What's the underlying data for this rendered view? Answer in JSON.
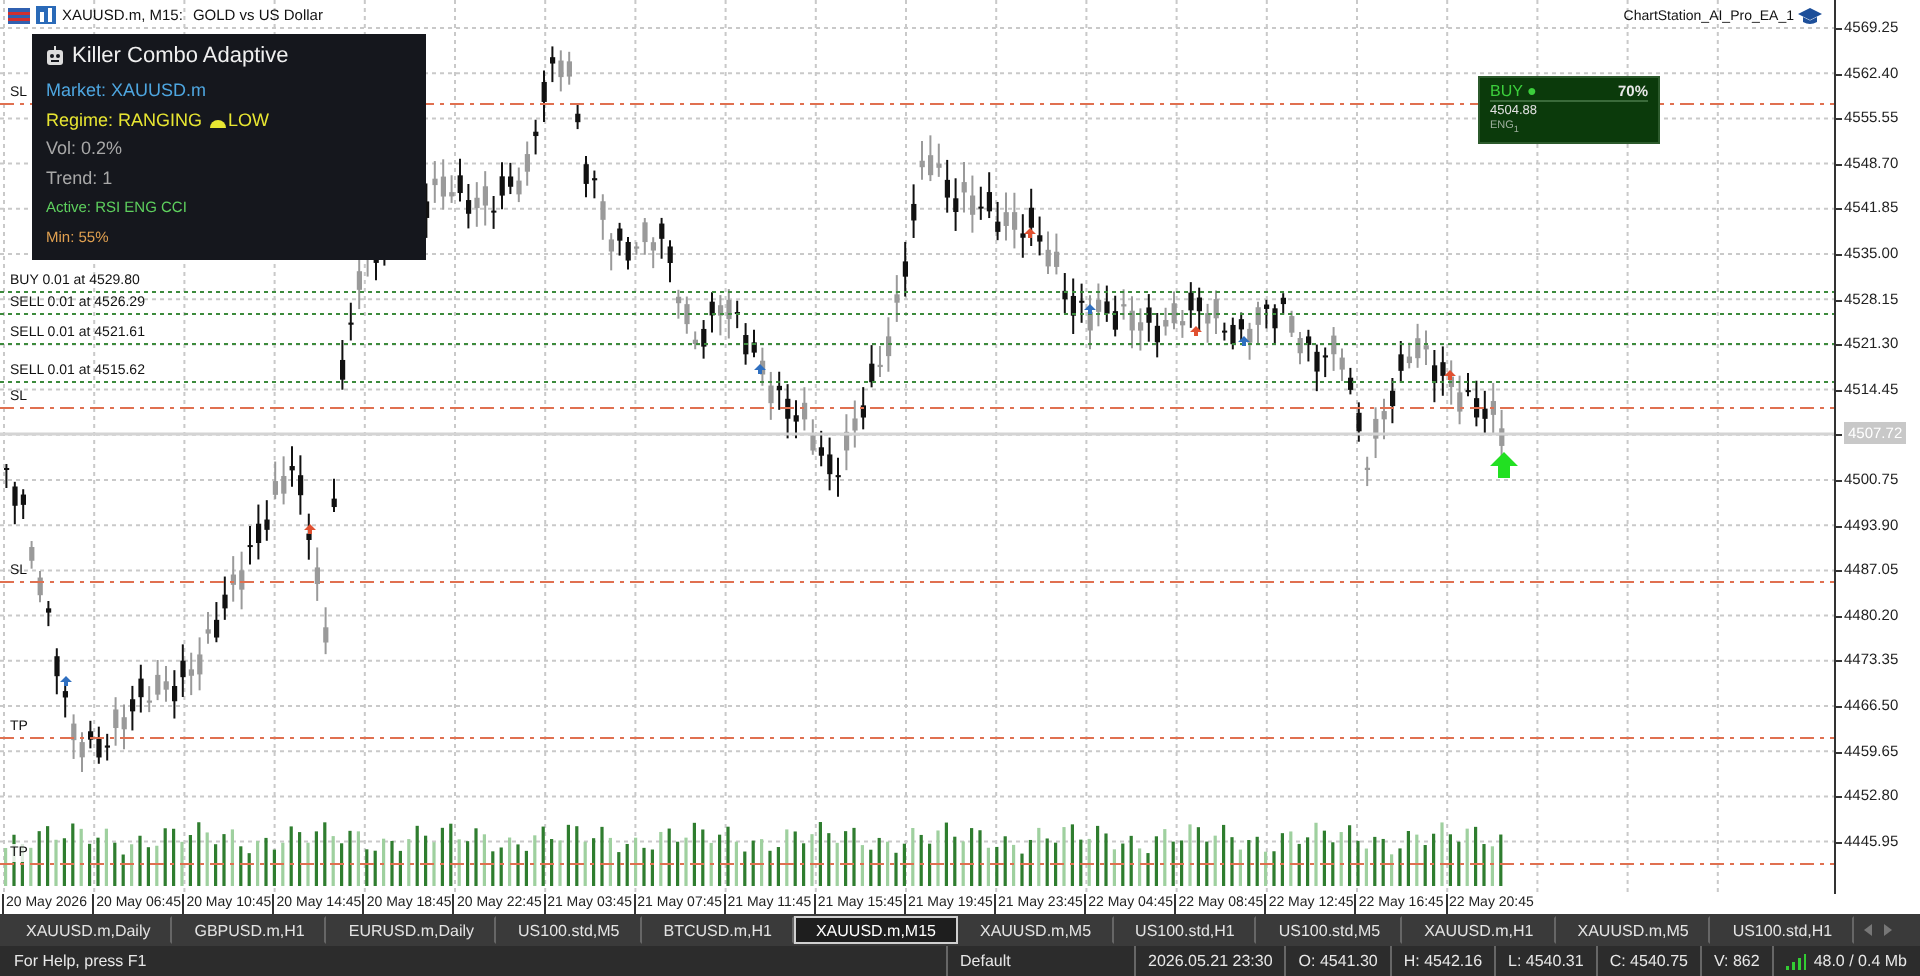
{
  "chart_header": {
    "symbol": "XAUUSD.m, M15:",
    "description": "GOLD vs US Dollar"
  },
  "info_panel": {
    "title": "Killer Combo Adaptive",
    "lines": [
      {
        "kind": "text",
        "text": "Market: XAUUSD.m",
        "color": "#4ea6e0"
      },
      {
        "kind": "regime",
        "text": "Regime: RANGING",
        "badge": "LOW",
        "color": "#e8e632"
      },
      {
        "kind": "text",
        "text": "Vol: 0.2%",
        "color": "#a8a8a8"
      },
      {
        "kind": "text",
        "text": "Trend: 1",
        "color": "#a8a8a8"
      },
      {
        "kind": "small",
        "text": "Active: RSI ENG CCI",
        "color": "#5ed05e"
      },
      {
        "kind": "small",
        "text": "Min: 55%",
        "color": "#e0a050"
      }
    ]
  },
  "expert": {
    "name": "ChartStation_AI_Pro_EA_1"
  },
  "signal": {
    "direction": "BUY ●",
    "confidence": "70%",
    "price": "4504.88",
    "tag": "ENG$_{1}$"
  },
  "levels": [
    {
      "kind": "stop",
      "label": "SL"
    },
    {
      "kind": "order",
      "label": "BUY 0.01 at 4529.80"
    },
    {
      "kind": "order",
      "label": "SELL 0.01 at 4526.29"
    },
    {
      "kind": "order",
      "label": "SELL 0.01 at 4521.61"
    },
    {
      "kind": "order",
      "label": "SELL 0.01 at 4515.62"
    },
    {
      "kind": "stop",
      "label": "SL"
    },
    {
      "kind": "stop",
      "label": "SL"
    },
    {
      "kind": "stop",
      "label": "TP"
    },
    {
      "kind": "stop",
      "label": "TP"
    }
  ],
  "price_axis": {
    "ticks": [
      "4569.25",
      "4562.40",
      "4555.55",
      "4548.70",
      "4541.85",
      "4535.00",
      "4528.15",
      "4521.30",
      "4514.45",
      "4500.75",
      "4493.90",
      "4487.05",
      "4480.20",
      "4473.35",
      "4466.50",
      "4459.65",
      "4452.80",
      "4445.95"
    ],
    "current_price": "4507.72"
  },
  "time_axis": [
    "20 May 2026",
    "20 May 06:45",
    "20 May 10:45",
    "20 May 14:45",
    "20 May 18:45",
    "20 May 22:45",
    "21 May 03:45",
    "21 May 07:45",
    "21 May 11:45",
    "21 May 15:45",
    "21 May 19:45",
    "21 May 23:45",
    "22 May 04:45",
    "22 May 08:45",
    "22 May 12:45",
    "22 May 16:45",
    "22 May 20:45"
  ],
  "tabs": [
    {
      "label": "XAUUSD.m,Daily",
      "selected": false
    },
    {
      "label": "GBPUSD.m,H1",
      "selected": false
    },
    {
      "label": "EURUSD.m,Daily",
      "selected": false
    },
    {
      "label": "US100.std,M5",
      "selected": false
    },
    {
      "label": "BTCUSD.m,H1",
      "selected": false
    },
    {
      "label": "XAUUSD.m,M15",
      "selected": true
    },
    {
      "label": "XAUUSD.m,M5",
      "selected": false
    },
    {
      "label": "US100.std,H1",
      "selected": false
    },
    {
      "label": "US100.std,M5",
      "selected": false
    },
    {
      "label": "XAUUSD.m,H1",
      "selected": false
    },
    {
      "label": "XAUUSD.m,M5",
      "selected": false
    },
    {
      "label": "US100.std,H1",
      "selected": false
    }
  ],
  "status_bar": {
    "help": "For Help, press F1",
    "profile": "Default",
    "fields": [
      "2026.05.21 23:30",
      "O: 4541.30",
      "H: 4542.16",
      "L: 4540.31",
      "C: 4540.75",
      "V: 862"
    ],
    "memory": "48.0 / 0.4 Mb"
  }
}
